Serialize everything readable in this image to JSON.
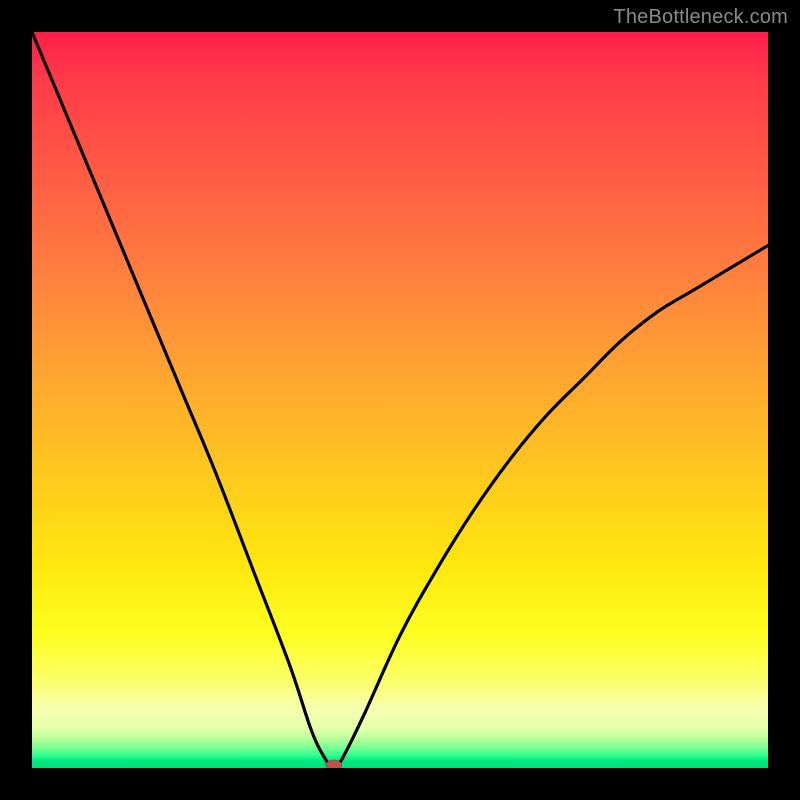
{
  "watermark": "TheBottleneck.com",
  "chart_data": {
    "type": "line",
    "title": "",
    "xlabel": "",
    "ylabel": "",
    "xlim": [
      0,
      100
    ],
    "ylim": [
      0,
      100
    ],
    "grid": false,
    "legend": false,
    "series": [
      {
        "name": "bottleneck-curve",
        "x": [
          0,
          5,
          10,
          15,
          20,
          25,
          30,
          35,
          38,
          40,
          41,
          42,
          45,
          50,
          55,
          60,
          65,
          70,
          75,
          80,
          85,
          90,
          95,
          100
        ],
        "y": [
          100,
          88,
          76,
          64,
          52,
          40,
          27,
          14,
          5,
          1,
          0,
          1,
          7,
          18,
          27,
          35,
          42,
          48,
          53,
          58,
          62,
          65,
          68,
          71
        ]
      }
    ],
    "marker": {
      "name": "optimal-point",
      "x": 41,
      "y": 0,
      "color": "#c1514e",
      "rx": 8,
      "ry": 5
    },
    "background_gradient": {
      "stops": [
        {
          "pos": 0.0,
          "color": "#ff1d4a"
        },
        {
          "pos": 0.06,
          "color": "#ff3949"
        },
        {
          "pos": 0.18,
          "color": "#ff5845"
        },
        {
          "pos": 0.32,
          "color": "#ff7d3f"
        },
        {
          "pos": 0.46,
          "color": "#ffa432"
        },
        {
          "pos": 0.6,
          "color": "#ffc81f"
        },
        {
          "pos": 0.72,
          "color": "#ffe60f"
        },
        {
          "pos": 0.82,
          "color": "#feff21"
        },
        {
          "pos": 0.88,
          "color": "#fbff68"
        },
        {
          "pos": 0.92,
          "color": "#f6ffb0"
        },
        {
          "pos": 0.945,
          "color": "#e5ffa8"
        },
        {
          "pos": 0.96,
          "color": "#b8ff9a"
        },
        {
          "pos": 0.972,
          "color": "#7cff95"
        },
        {
          "pos": 0.982,
          "color": "#35ff8f"
        },
        {
          "pos": 0.99,
          "color": "#00e97f"
        },
        {
          "pos": 1.0,
          "color": "#00df7a"
        }
      ]
    }
  }
}
